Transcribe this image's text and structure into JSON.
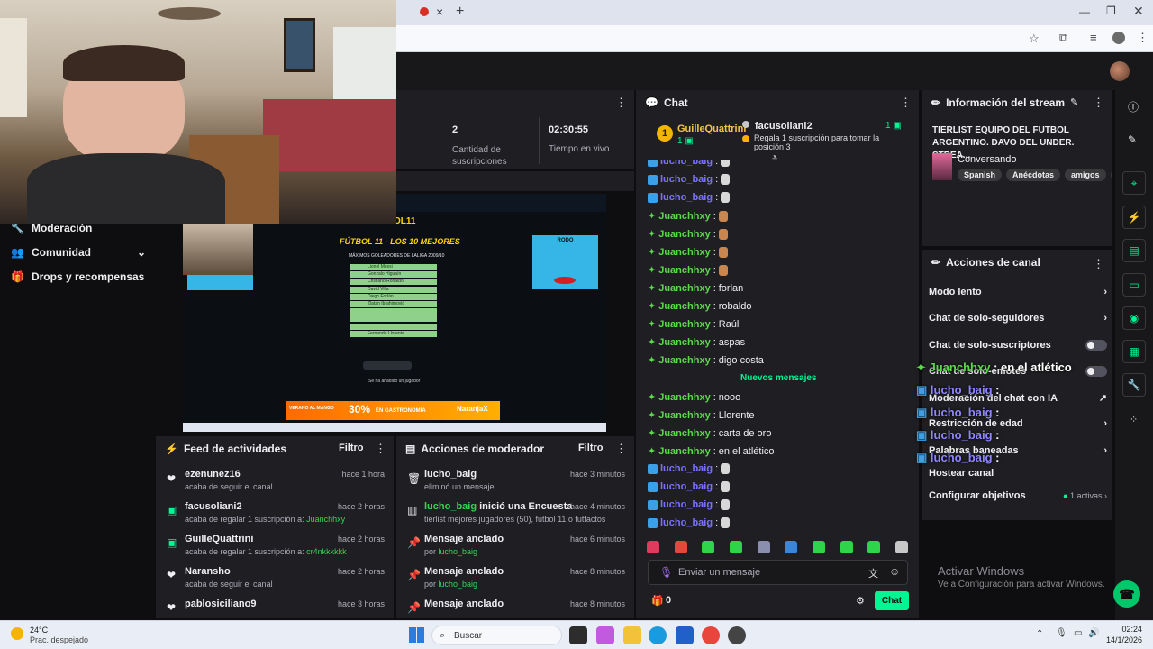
{
  "browser": {
    "tab_close_glyph": "×",
    "new_tab_glyph": "+"
  },
  "webcam_overlay": {
    "logo_text": "OL11",
    "slide_title": "FÚTBOL 11 - LOS 10 MEJORES",
    "slide_subtitle": "MÁXIMOS GOLEADORES DE LALIGA 2009/10",
    "players": [
      "Lionel Messi",
      "Gonzalo Higuaín",
      "Cristiano Ronaldo",
      "David Villa",
      "Diego Forlán",
      "Zlatan Ibrahimović",
      "",
      "",
      "",
      "Fernando Llorente"
    ],
    "rodo_label": "RODO",
    "add_player_text": "Se ha añadido un jugador",
    "ad_text_1": "VERANO AL MANGO",
    "ad_text_2": "30%",
    "ad_text_3": "EN GASTRONOMÍA",
    "ad_text_4": "NaranjaX"
  },
  "stats": {
    "subs_value": "2",
    "subs_label": "Cantidad de suscripciones",
    "time_value": "02:30:55",
    "time_label": "Tiempo en vivo"
  },
  "sidebar": {
    "items": [
      {
        "label": "Moderación",
        "icon": "wrench-icon"
      },
      {
        "label": "Comunidad",
        "icon": "people-icon"
      },
      {
        "label": "Drops y recompensas",
        "icon": "gift-icon"
      }
    ]
  },
  "feed": {
    "title": "Feed de actividades",
    "filter": "Filtro",
    "items": [
      {
        "name": "ezenunez16",
        "time": "hace 1 hora",
        "sub": "acaba de seguir el canal",
        "highlight": "",
        "icon": "heart"
      },
      {
        "name": "facusoliani2",
        "time": "hace 2 horas",
        "sub": "acaba de regalar 1 suscripción a:",
        "highlight": "Juanchhxy",
        "icon": "gift"
      },
      {
        "name": "GuilleQuattrini",
        "time": "hace 2 horas",
        "sub": "acaba de regalar 1 suscripción a:",
        "highlight": "cr4nkkkkkk",
        "icon": "gift"
      },
      {
        "name": "Naransho",
        "time": "hace 2 horas",
        "sub": "acaba de seguir el canal",
        "highlight": "",
        "icon": "heart"
      },
      {
        "name": "pablosiciliano9",
        "time": "hace 3 horas",
        "sub": "",
        "highlight": "",
        "icon": "heart"
      }
    ]
  },
  "modactions": {
    "title": "Acciones de moderador",
    "filter": "Filtro",
    "items": [
      {
        "title": "lucho_baig",
        "title_green": "",
        "time": "hace 3 minutos",
        "sub": "eliminó un mensaje",
        "by": ""
      },
      {
        "title": " inició una Encuesta",
        "title_green": "lucho_baig",
        "time": "hace 4 minutos",
        "sub": "tierlist mejores jugadores (50), futbol 11 o futfactos",
        "by": ""
      },
      {
        "title": "Mensaje anclado",
        "title_green": "",
        "time": "hace 6 minutos",
        "sub": "por ",
        "by": "lucho_baig"
      },
      {
        "title": "Mensaje anclado",
        "title_green": "",
        "time": "hace 8 minutos",
        "sub": "por ",
        "by": "lucho_baig"
      },
      {
        "title": "Mensaje anclado",
        "title_green": "",
        "time": "hace 8 minutos",
        "sub": "",
        "by": ""
      }
    ]
  },
  "chat": {
    "title": "Chat",
    "leader_rank": "1",
    "leader_name": "GuilleQuattrini",
    "leader_count": "1",
    "gifter_name": "facusoliani2",
    "gifter_count": "1",
    "gifter_note": "Regala 1 suscripción para tomar la posición 3",
    "messages_top": [
      {
        "user": "lucho_baig",
        "text": "",
        "emote": true,
        "color": "blue"
      },
      {
        "user": "lucho_baig",
        "text": "",
        "emote": true,
        "color": "blue"
      },
      {
        "user": "lucho_baig",
        "text": "",
        "emote": true,
        "color": "blue"
      },
      {
        "user": "Juanchhxy",
        "text": "",
        "emote": true,
        "color": "green"
      },
      {
        "user": "Juanchhxy",
        "text": "",
        "emote": true,
        "color": "green"
      },
      {
        "user": "Juanchhxy",
        "text": "",
        "emote": true,
        "color": "green"
      },
      {
        "user": "Juanchhxy",
        "text": "",
        "emote": true,
        "color": "green"
      },
      {
        "user": "Juanchhxy",
        "text": "forlan",
        "emote": false,
        "color": "green"
      },
      {
        "user": "Juanchhxy",
        "text": "robaldo",
        "emote": false,
        "color": "green"
      },
      {
        "user": "Juanchhxy",
        "text": "Raúl",
        "emote": false,
        "color": "green"
      },
      {
        "user": "Juanchhxy",
        "text": "aspas",
        "emote": false,
        "color": "green"
      },
      {
        "user": "Juanchhxy",
        "text": "digo costa",
        "emote": false,
        "color": "green"
      }
    ],
    "new_messages_label": "Nuevos mensajes",
    "messages_bottom": [
      {
        "user": "Juanchhxy",
        "text": "nooo",
        "emote": false,
        "color": "green"
      },
      {
        "user": "Juanchhxy",
        "text": "Llorente",
        "emote": false,
        "color": "green"
      },
      {
        "user": "Juanchhxy",
        "text": "carta de oro",
        "emote": false,
        "color": "green"
      },
      {
        "user": "Juanchhxy",
        "text": "en el atlético",
        "emote": false,
        "color": "green"
      },
      {
        "user": "lucho_baig",
        "text": "",
        "emote": true,
        "color": "blue"
      },
      {
        "user": "lucho_baig",
        "text": "",
        "emote": true,
        "color": "blue"
      },
      {
        "user": "lucho_baig",
        "text": "",
        "emote": true,
        "color": "blue"
      },
      {
        "user": "lucho_baig",
        "text": "",
        "emote": true,
        "color": "blue"
      }
    ],
    "input_placeholder": "Enviar un mensaje",
    "points": "0",
    "send_label": "Chat"
  },
  "stream_info": {
    "title": "Información del stream",
    "stream_title": "TIERLIST EQUIPO DEL FUTBOL ARGENTINO. DAVO DEL UNDER. STREA...",
    "category": "Conversando",
    "tags": [
      "Spanish",
      "Anécdotas",
      "amigos",
      "ar"
    ]
  },
  "channel_actions": {
    "title": "Acciones de canal",
    "rows": [
      {
        "label": "Modo lento",
        "control": "chevron"
      },
      {
        "label": "Chat de solo-seguidores",
        "control": "chevron"
      },
      {
        "label": "Chat de solo-suscriptores",
        "control": "toggle"
      },
      {
        "label": "Chat de solo-emotes",
        "control": "toggle"
      },
      {
        "label": "Moderación del chat con IA",
        "control": "external"
      },
      {
        "label": "Restricción de edad",
        "control": "chevron"
      },
      {
        "label": "Palabras baneadas",
        "control": "chevron"
      },
      {
        "label": "Hostear canal",
        "control": "none"
      },
      {
        "label": "Configurar objetivos",
        "control": "chevron"
      }
    ],
    "goals_active": "1 activas"
  },
  "overlay_chat": [
    {
      "user": "Juanchhxy",
      "text": "en el atlético",
      "color": "green"
    },
    {
      "user": "lucho_baig",
      "text": "",
      "color": "blue"
    },
    {
      "user": "lucho_baig",
      "text": "",
      "color": "blue"
    },
    {
      "user": "lucho_baig",
      "text": "",
      "color": "blue"
    },
    {
      "user": "lucho_baig",
      "text": "",
      "color": "blue"
    }
  ],
  "windows_watermark": {
    "line1": "Activar Windows",
    "line2": "Ve a Configuración para activar Windows."
  },
  "taskbar": {
    "weather_temp": "24°C",
    "weather_desc": "Prac. despejado",
    "search_placeholder": "Buscar",
    "time": "02:24",
    "date": "14/1/2026"
  },
  "colors": {
    "kick_green": "#00f593",
    "panel_bg": "#1f1f23",
    "page_bg": "#0e0e10"
  }
}
